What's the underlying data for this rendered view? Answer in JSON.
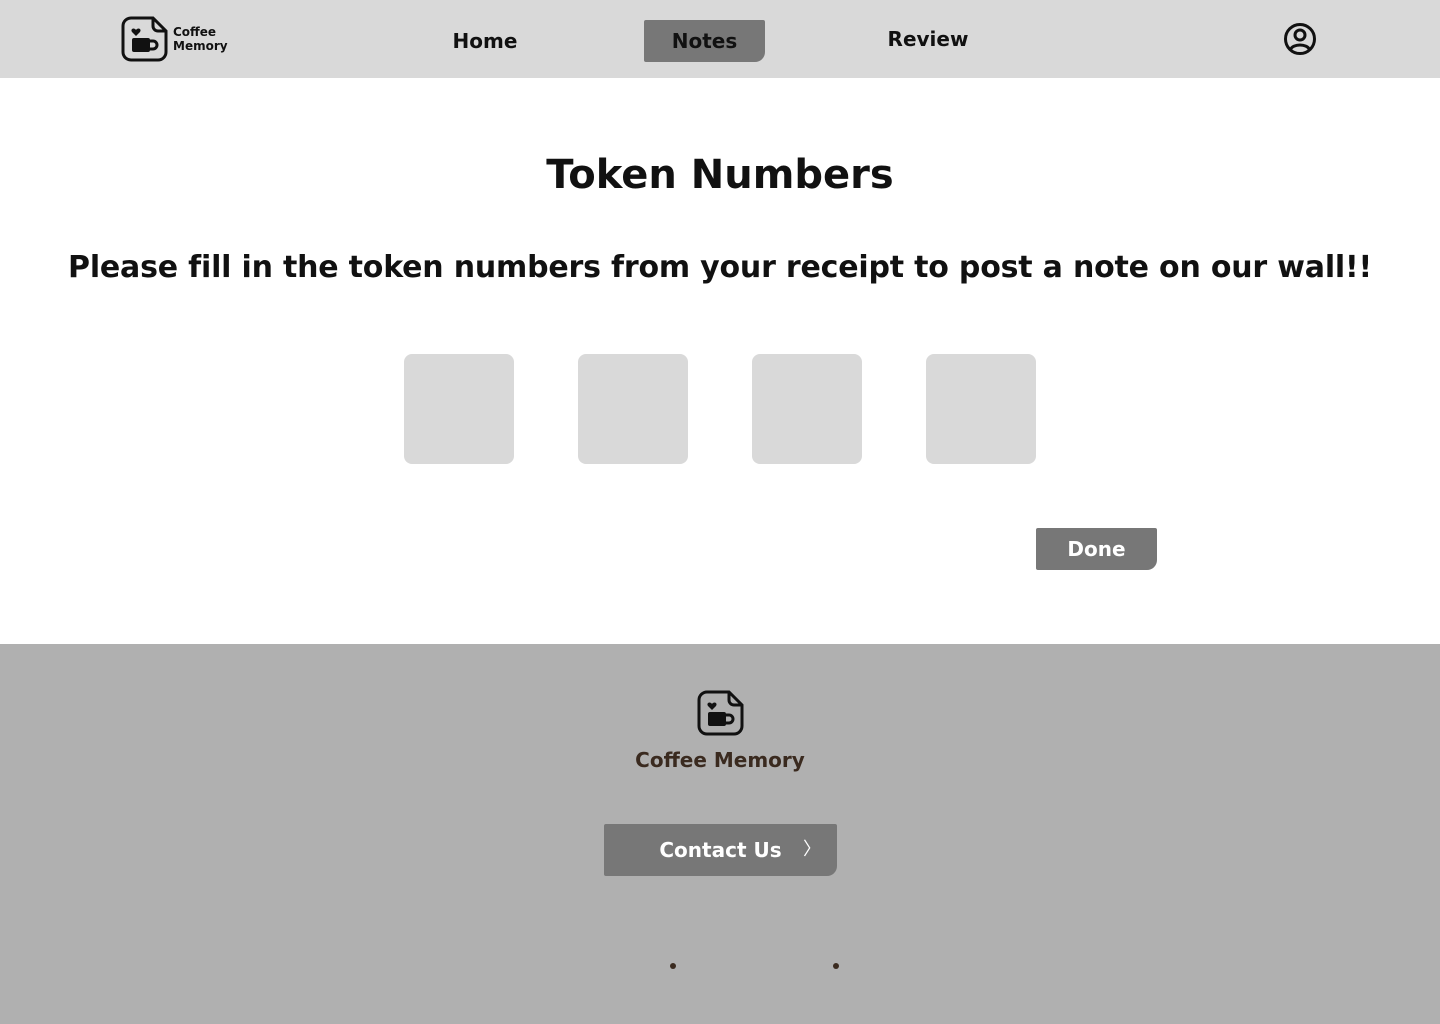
{
  "header": {
    "brand_line1": "Coffee",
    "brand_line2": "Memory",
    "nav": {
      "home": "Home",
      "notes": "Notes",
      "review": "Review"
    },
    "active_tab": "Notes",
    "icons": {
      "logo": "coffee-note-logo-icon",
      "profile": "user-circle-icon"
    }
  },
  "main": {
    "title": "Token Numbers",
    "instruction": "Please fill in the token numbers from your receipt to post a note on our wall!!",
    "tokens": [
      "",
      "",
      "",
      ""
    ],
    "done_label": "Done"
  },
  "footer": {
    "brand": "Coffee Memory",
    "contact_label": "Contact Us",
    "contact_chevron": "〉",
    "icons": {
      "logo": "coffee-note-logo-icon"
    }
  },
  "colors": {
    "header_bg": "#d9d9d9",
    "active_tab_bg": "#777777",
    "token_box_bg": "#d9d9d9",
    "button_bg": "#777777",
    "footer_bg": "#b0b0b0",
    "footer_text": "#3a2a1f"
  }
}
